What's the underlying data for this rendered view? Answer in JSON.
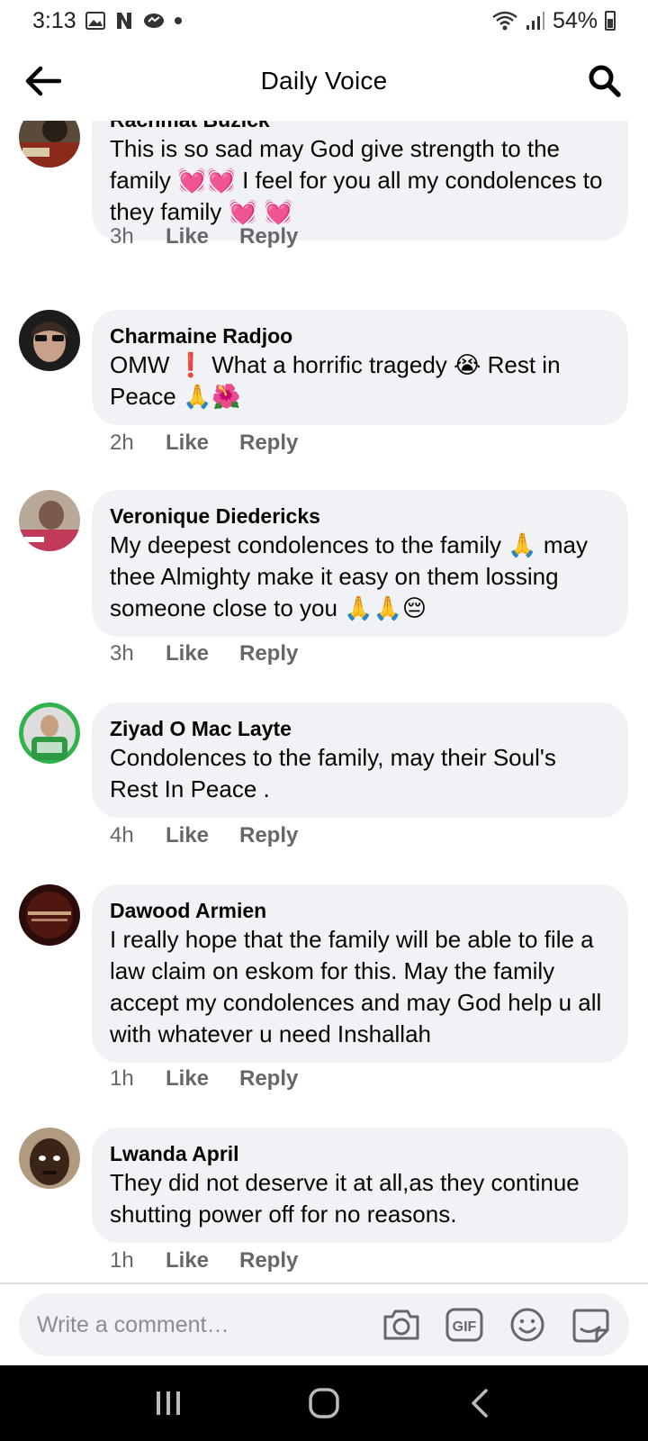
{
  "status_bar": {
    "time": "3:13",
    "battery": "54%"
  },
  "header": {
    "title": "Daily Voice"
  },
  "comments": [
    {
      "author": "Rachmat Buzick",
      "text": "This is so sad may God give strength to the family 💓💓 I feel for you all my condolences to they family 💓 💓",
      "time": "3h",
      "like": "Like",
      "reply": "Reply"
    },
    {
      "author": "Charmaine Radjoo",
      "text": "OMW ❗ What a horrific tragedy 😭 Rest in Peace 🙏🌺",
      "time": "2h",
      "like": "Like",
      "reply": "Reply"
    },
    {
      "author": "Veronique Diedericks",
      "text": "My deepest condolences to the family 🙏 may thee Almighty make it easy on them lossing someone close to you 🙏🙏😔",
      "time": "3h",
      "like": "Like",
      "reply": "Reply"
    },
    {
      "author": "Ziyad O Mac Layte",
      "text": "Condolences to the family, may their Soul's Rest In Peace .",
      "time": "4h",
      "like": "Like",
      "reply": "Reply"
    },
    {
      "author": "Dawood Armien",
      "text": "I really hope that the family will be able to file a law claim on eskom  for this. May the family accept my condolences and may God help u all with whatever u need Inshallah",
      "time": "1h",
      "like": "Like",
      "reply": "Reply"
    },
    {
      "author": "Lwanda April",
      "text": "They did not deserve it at all,as they continue shutting power off for no reasons.",
      "time": "1h",
      "like": "Like",
      "reply": "Reply"
    }
  ],
  "composer": {
    "placeholder": "Write a comment…",
    "gif_label": "GIF"
  },
  "icons": {
    "back": "arrow-left-icon",
    "search": "search-icon",
    "camera": "camera-icon",
    "gif": "gif-icon",
    "emoji": "emoji-icon",
    "sticker": "sticker-icon"
  },
  "colors": {
    "bubble": "#f0f2f5",
    "secondary_text": "#65676b",
    "navbar": "#000000"
  }
}
